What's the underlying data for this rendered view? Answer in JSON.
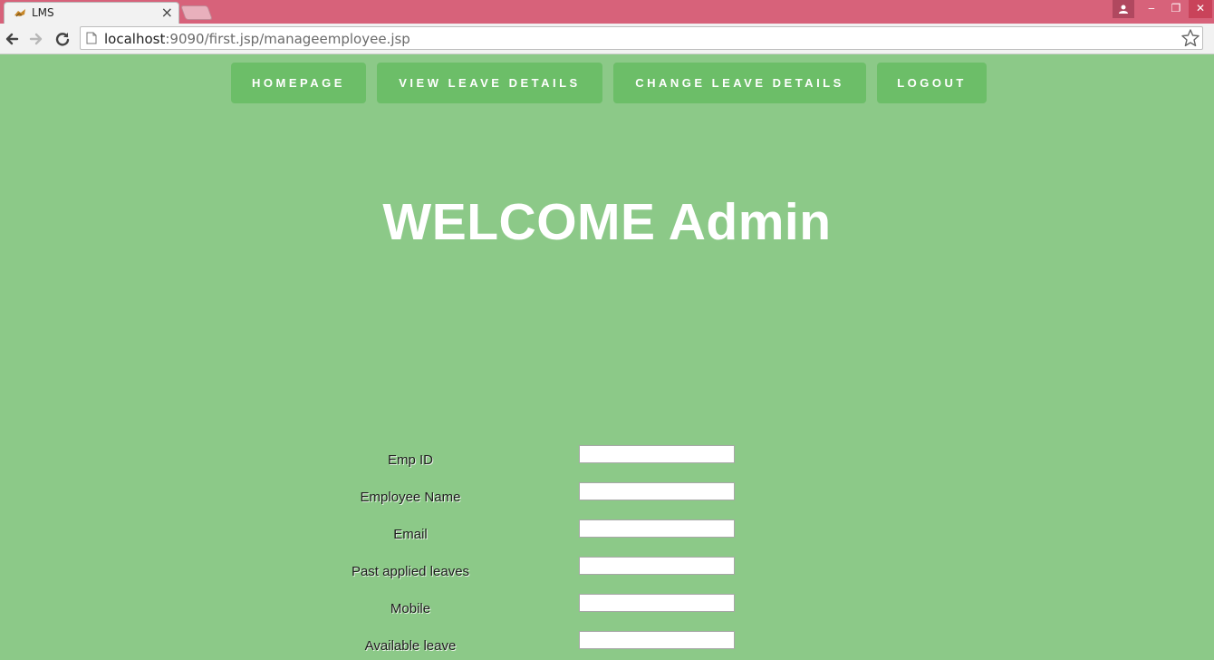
{
  "browser": {
    "tab_title": "LMS",
    "tab_close": "×",
    "url_host": "localhost",
    "url_rest": ":9090/first.jsp/manageemployee.jsp",
    "window_controls": [
      "‒",
      "❐",
      "✕"
    ]
  },
  "nav": {
    "items": [
      {
        "label": "HOMEPAGE"
      },
      {
        "label": "VIEW LEAVE DETAILS"
      },
      {
        "label": "CHANGE LEAVE DETAILS"
      },
      {
        "label": "LOGOUT"
      }
    ]
  },
  "heading": "WELCOME Admin",
  "form": {
    "fields": [
      {
        "label": "Emp ID",
        "value": ""
      },
      {
        "label": "Employee Name",
        "value": ""
      },
      {
        "label": "Email",
        "value": ""
      },
      {
        "label": "Past applied leaves",
        "value": ""
      },
      {
        "label": "Mobile",
        "value": ""
      },
      {
        "label": "Available leave",
        "value": ""
      }
    ]
  },
  "colors": {
    "page_background": "#8cc988",
    "menu_button": "#6cbe68",
    "titlebar": "#d7627a"
  }
}
